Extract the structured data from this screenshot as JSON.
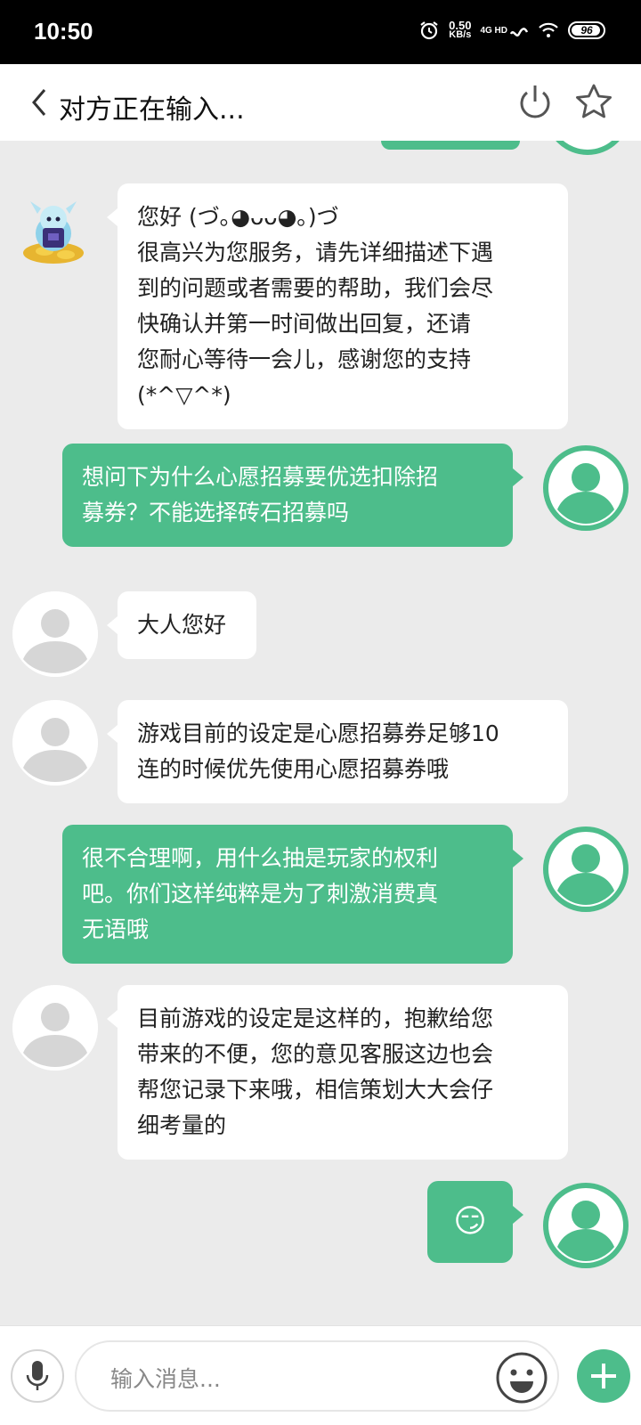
{
  "status_bar": {
    "time": "10:50",
    "net_speed_value": "0.50",
    "net_speed_unit": "KB/s",
    "signal": "4G HD",
    "battery": "96"
  },
  "header": {
    "title": "对方正在输入..."
  },
  "messages": [
    {
      "side": "left",
      "avatar": "mascot-avatar",
      "lines": [
        "您好 (づ｡◕ᴗᴗ◕｡)づ",
        "很高兴为您服务，请先详细描述下遇",
        "到的问题或者需要的帮助，我们会尽",
        "快确认并第一时间做出回复，还请",
        "您耐心等待一会儿，感谢您的支持",
        "(*^▽^*)"
      ]
    },
    {
      "side": "right",
      "avatar": "user-avatar",
      "lines": [
        "想问下为什么心愿招募要优选扣除招",
        "募券？不能选择砖石招募吗"
      ]
    },
    {
      "side": "left",
      "avatar": "agent-avatar",
      "lines": [
        "大人您好"
      ]
    },
    {
      "side": "left",
      "avatar": "agent-avatar",
      "lines": [
        "游戏目前的设定是心愿招募券足够10",
        "连的时候优先使用心愿招募券哦"
      ]
    },
    {
      "side": "right",
      "avatar": "user-avatar",
      "lines": [
        "很不合理啊，用什么抽是玩家的权利",
        "吧。你们这样纯粹是为了刺激消费真",
        "无语哦"
      ]
    },
    {
      "side": "left",
      "avatar": "agent-avatar",
      "lines": [
        "目前游戏的设定是这样的，抱歉给您",
        "带来的不便，您的意见客服这边也会",
        "帮您记录下来哦，相信策划大大会仔",
        "细考量的"
      ]
    },
    {
      "side": "right",
      "avatar": "user-avatar",
      "lines": [
        "😏"
      ]
    }
  ],
  "input": {
    "placeholder": "输入消息..."
  },
  "colors": {
    "accent": "#4dbd8b",
    "background": "#ebebeb"
  }
}
